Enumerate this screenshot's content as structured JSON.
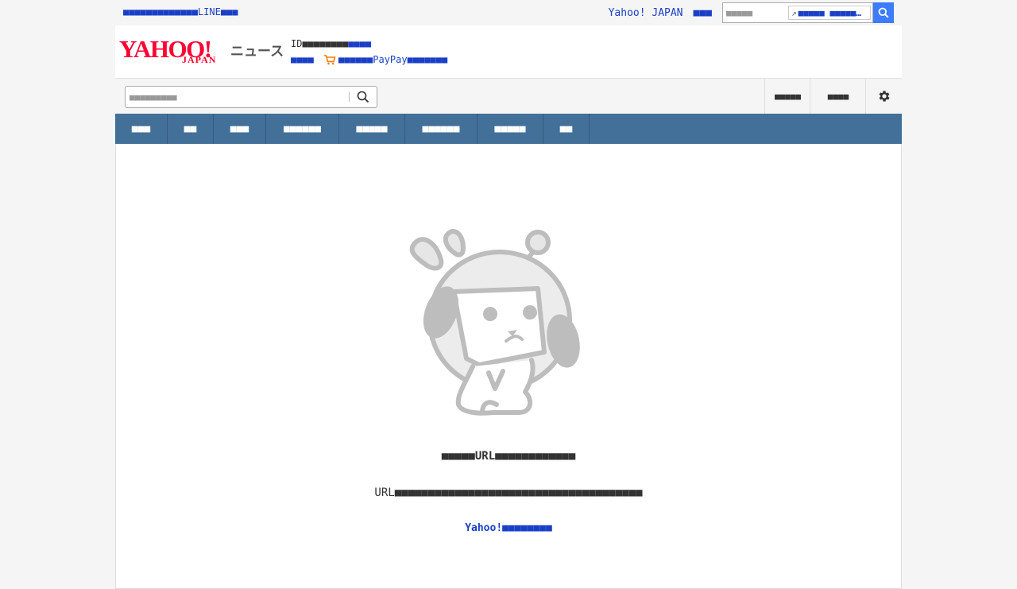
{
  "topbar": {
    "promo_link": "■■■■■■■■■■■■■LINE■■■",
    "yahoo_japan_link": "Yahoo! JAPAN",
    "help_link": "■■■",
    "search_placeholder": "■■■■■",
    "suggest_text": "■■■■■ ■■■■■…"
  },
  "header": {
    "logo_yahoo": "YAHOO!",
    "logo_japan": "JAPAN",
    "logo_news": "ニュース",
    "login_text": "ID■■■■■■■■",
    "login_link": "■■■■",
    "register_link": "■■■■",
    "paypay_link": "■■■■■■PayPay■■■■■■■"
  },
  "toolbar": {
    "search_placeholder": "■■■■■■■■■",
    "tool_1": "■■■■■",
    "tool_2": "■■■■"
  },
  "nav": {
    "items": [
      "■■■",
      "■■",
      "■■■",
      "■■■■■■",
      "■■■■■",
      "■■■■■■",
      "■■■■■",
      "■■"
    ]
  },
  "error": {
    "title": "■■■■■URL■■■■■■■■■■■■",
    "description": "URL■■■■■■■■■■■■■■■■■■■■■■■■■■■■■■■■■■■■■",
    "back_link": "Yahoo!■■■■■■■■"
  },
  "colors": {
    "nav_bg": "#437099",
    "link": "#1a3fc7",
    "logo": "#ff0033",
    "search_button": "#3d7bff"
  }
}
